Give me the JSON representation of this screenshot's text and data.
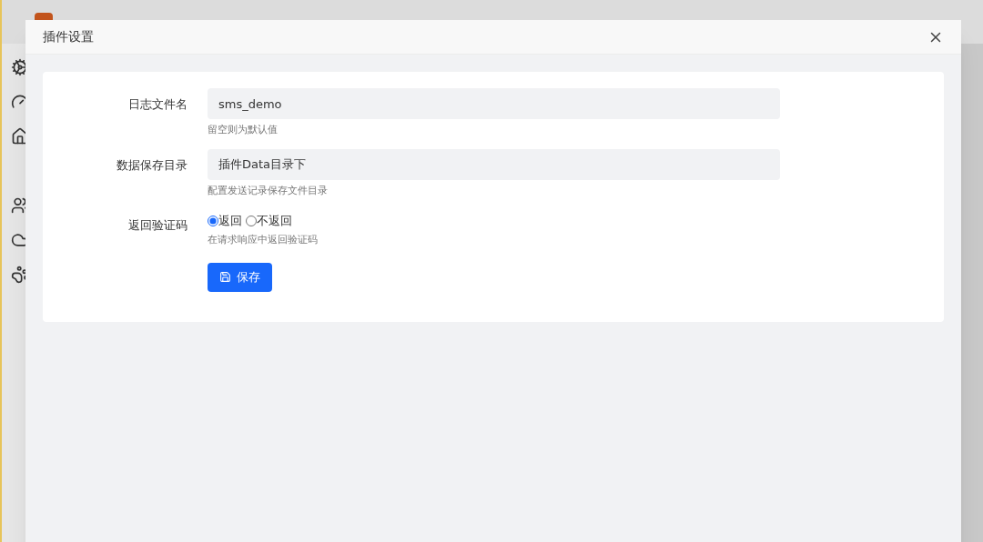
{
  "modal": {
    "title": "插件设置",
    "fields": [
      {
        "kind": "text",
        "label": "日志文件名",
        "value": "sms_demo",
        "help": "留空则为默认值"
      },
      {
        "kind": "text",
        "label": "数据保存目录",
        "value": "插件Data目录下",
        "help": "配置发送记录保存文件目录"
      },
      {
        "kind": "radio",
        "label": "返回验证码",
        "options": [
          {
            "label": "返回",
            "selected": true
          },
          {
            "label": "不返回",
            "selected": false
          }
        ],
        "help": "在请求响应中返回验证码"
      }
    ],
    "submit": "保存"
  }
}
